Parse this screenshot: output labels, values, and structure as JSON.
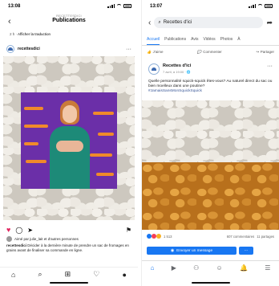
{
  "instagram": {
    "status_time": "13:08",
    "account_label": "RECETTESDICI",
    "title": "Publications",
    "time_ago": "2 h",
    "translate_label": "Afficher la traduction",
    "username": "recettesdici",
    "likes_text": "Aimé par julie_lait et d'autres personnes",
    "caption_user": "recettesdici",
    "caption_text": "Décider à la dernière minute de prendre un sac de fromages en grains avant de finaliser sa commande en ligne.",
    "icons": [
      "back-icon",
      "more-icon",
      "heart-icon",
      "comment-icon",
      "share-icon",
      "bookmark-icon",
      "home-icon",
      "search-icon",
      "add-icon",
      "activity-icon",
      "profile-icon"
    ]
  },
  "facebook": {
    "status_time": "13:07",
    "search_text": "Recettes d'ici",
    "tabs": [
      "Accueil",
      "Publications",
      "Avis",
      "Vidéos",
      "Photos",
      "À"
    ],
    "active_tab": "Accueil",
    "page_buttons": [
      "J'aime",
      "Commenter",
      "Partager"
    ],
    "post_author": "Recettes d'ici",
    "post_date": "7 avril, à 19:00 · 🌐",
    "post_text": "Quelle personnalité squick-squick êtes-vous? Au naturel direct du sac ou bien moelleux dans une poutine?",
    "post_hashtag": "#JamaisSansMonSquickSquick",
    "reactions_count": "1 513",
    "comments_count": "607 commentaires",
    "shares_count": "11 partages",
    "send_button": "Envoyer un message",
    "colors": {
      "brand": "#1877f2",
      "orange": "#f08a2a",
      "purple": "#6b2fa8"
    }
  }
}
